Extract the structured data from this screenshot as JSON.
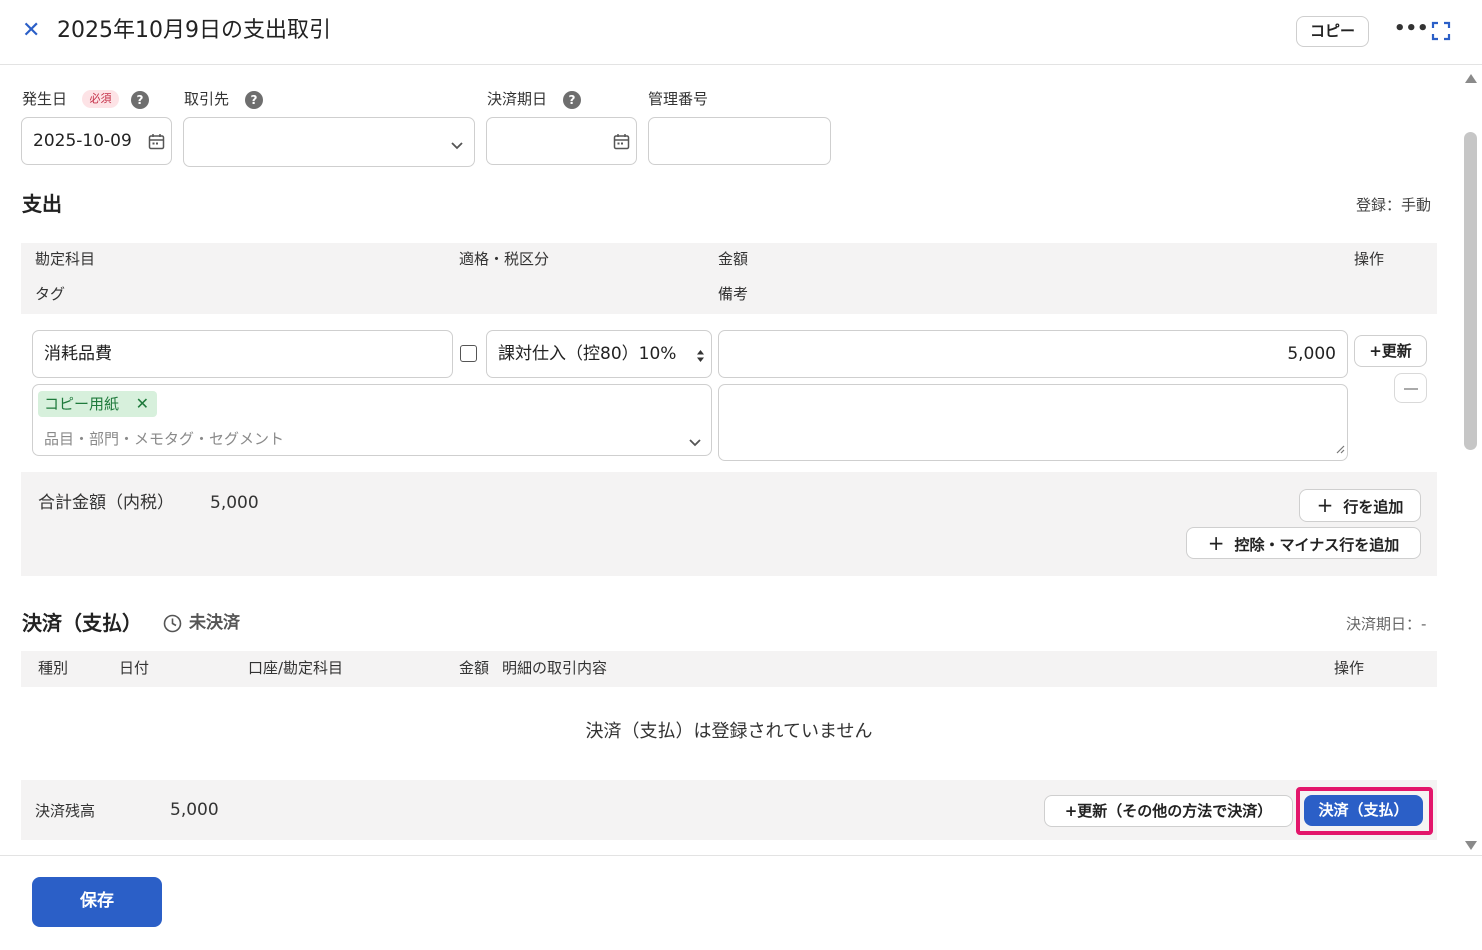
{
  "header": {
    "title": "2025年10月9日の支出取引",
    "copy_label": "コピー",
    "close_icon": "close-icon",
    "more_icon": "more-icon",
    "expand_icon": "fullscreen-icon"
  },
  "basic": {
    "date_label": "発生日",
    "required_badge": "必須",
    "date_value": "2025-10-09",
    "partner_label": "取引先",
    "partner_value": "",
    "due_label": "決済期日",
    "due_value": "",
    "mgmt_label": "管理番号",
    "mgmt_value": ""
  },
  "expense": {
    "title": "支出",
    "registration": "登録：手動",
    "headers": {
      "account": "勘定科目",
      "tax": "適格・税区分",
      "amount": "金額",
      "ops": "操作",
      "tag": "タグ",
      "remarks": "備考"
    },
    "row": {
      "account": "消耗品費",
      "tax": "課対仕入（控80）10%",
      "amount": "5,000",
      "update_label": "+更新",
      "tag_chip": "コピー用紙",
      "tag_placeholder": "品目・部門・メモタグ・セグメント",
      "remarks": ""
    },
    "total_label": "合計金額（内税）",
    "total_value": "5,000",
    "add_row_label": "行を追加",
    "add_deduction_label": "控除・マイナス行を追加"
  },
  "settlement": {
    "title": "決済（支払）",
    "status": "未決済",
    "due_text": "決済期日：-",
    "headers": {
      "type": "種別",
      "date": "日付",
      "account": "口座/勘定科目",
      "amount": "金額",
      "details": "明細の取引内容",
      "ops": "操作"
    },
    "empty_message": "決済（支払）は登録されていません",
    "balance_label": "決済残高",
    "balance_value": "5,000",
    "update_other_label": "+更新（その他の方法で決済）",
    "pay_label": "決済（支払）"
  },
  "footer": {
    "save_label": "保存"
  },
  "colors": {
    "accent": "#2b5fc7",
    "highlight": "#e3166b",
    "tag_bg": "#d7f0dc"
  }
}
